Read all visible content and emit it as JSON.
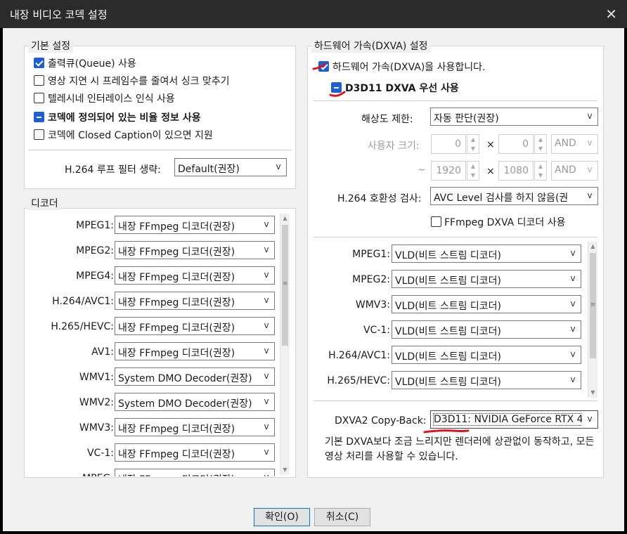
{
  "window": {
    "title": "내장 비디오 코덱 설정",
    "close_glyph": "✕"
  },
  "basic": {
    "legend": "기본 설정",
    "options": [
      {
        "label": "출력큐(Queue) 사용",
        "state": "checked",
        "bold": false
      },
      {
        "label": "영상 지연 시 프레임수를 줄여서 싱크 맞추기",
        "state": "unchecked",
        "bold": false
      },
      {
        "label": "텔레시네 인터레이스 인식 사용",
        "state": "unchecked",
        "bold": false
      },
      {
        "label": "코덱에 정의되어 있는 비율 정보 사용",
        "state": "partial",
        "bold": true
      },
      {
        "label": "코덱에 Closed Caption이 있으면 지원",
        "state": "unchecked",
        "bold": false
      }
    ],
    "loop_filter_label": "H.264 루프 필터 생략:",
    "loop_filter_value": "Default(권장)"
  },
  "decoder": {
    "legend": "디코더",
    "rows": [
      {
        "label": "MPEG1:",
        "value": "내장 FFmpeg 디코더(권장)"
      },
      {
        "label": "MPEG2:",
        "value": "내장 FFmpeg 디코더(권장)"
      },
      {
        "label": "MPEG4:",
        "value": "내장 FFmpeg 디코더(권장)"
      },
      {
        "label": "H.264/AVC1:",
        "value": "내장 FFmpeg 디코더(권장)"
      },
      {
        "label": "H.265/HEVC:",
        "value": "내장 FFmpeg 디코더(권장)"
      },
      {
        "label": "AV1:",
        "value": "내장 FFmpeg 디코더(권장)"
      },
      {
        "label": "WMV1:",
        "value": "System DMO Decoder(권장)"
      },
      {
        "label": "WMV2:",
        "value": "System DMO Decoder(권장)"
      },
      {
        "label": "WMV3:",
        "value": "내장 FFmpeg 디코더(권장)"
      },
      {
        "label": "VC-1:",
        "value": "내장 FFmpeg 디코더(권장)"
      },
      {
        "label": "MPEG:",
        "value": "내장 FFmpeg 디코더(권장)"
      }
    ]
  },
  "hw": {
    "legend": "하드웨어 가속(DXVA) 설정",
    "enable_label": "하드웨어 가속(DXVA)을 사용합니다.",
    "d3d11_label": "D3D11 DXVA 우선 사용",
    "resolution_label": "해상도 제한:",
    "resolution_value": "자동 판단(권장)",
    "user_size_label": "사용자 크기:",
    "min_w": "0",
    "min_h": "0",
    "max_prefix": "~",
    "max_w": "1920",
    "max_h": "1080",
    "times": "×",
    "and_label": "AND",
    "compat_label": "H.264 호환성 검사:",
    "compat_value": "AVC Level 검사를 하지 않음(권",
    "ffmpeg_dxva_label": "FFmpeg DXVA 디코더 사용",
    "rows": [
      {
        "label": "MPEG1:",
        "value": "VLD(비트 스트림 디코더)"
      },
      {
        "label": "MPEG2:",
        "value": "VLD(비트 스트림 디코더)"
      },
      {
        "label": "WMV3:",
        "value": "VLD(비트 스트림 디코더)"
      },
      {
        "label": "VC-1:",
        "value": "VLD(비트 스트림 디코더)"
      },
      {
        "label": "H.264/AVC1:",
        "value": "VLD(비트 스트림 디코더)"
      },
      {
        "label": "H.265/HEVC:",
        "value": "VLD(비트 스트림 디코더)"
      }
    ],
    "copyback_label": "DXVA2 Copy-Back:",
    "copyback_value": "D3D11: NVIDIA GeForce RTX 4",
    "description": "기본 DXVA보다 조금 느리지만 렌더러에 상관없이 동작하고, 모든 영상 처리를 사용할 수 있습니다."
  },
  "buttons": {
    "ok": "확인(O)",
    "cancel": "취소(C)"
  },
  "colors": {
    "accent": "#1e5fd1",
    "annotation": "#e0141e",
    "titlebar": "#2b2b2b"
  }
}
